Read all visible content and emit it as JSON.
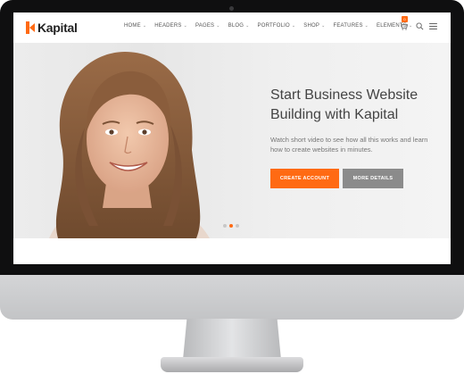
{
  "brand": {
    "name": "Kapital",
    "accent": "#ff6a13"
  },
  "nav": {
    "items": [
      "HOME",
      "HEADERS",
      "PAGES",
      "BLOG",
      "PORTFOLIO",
      "SHOP",
      "FEATURES",
      "ELEMENTS"
    ],
    "cart_count": "0",
    "icons": {
      "cart": "cart-icon",
      "search": "search-icon",
      "menu": "menu-icon"
    }
  },
  "hero": {
    "title": "Start Business Website Building with Kapital",
    "subtitle": "Watch short video to see how all this works and learn how to create websites in minutes.",
    "primary_button": "CREATE ACCOUNT",
    "secondary_button": "MORE DETAILS",
    "slides_total": 3,
    "active_slide": 2
  }
}
